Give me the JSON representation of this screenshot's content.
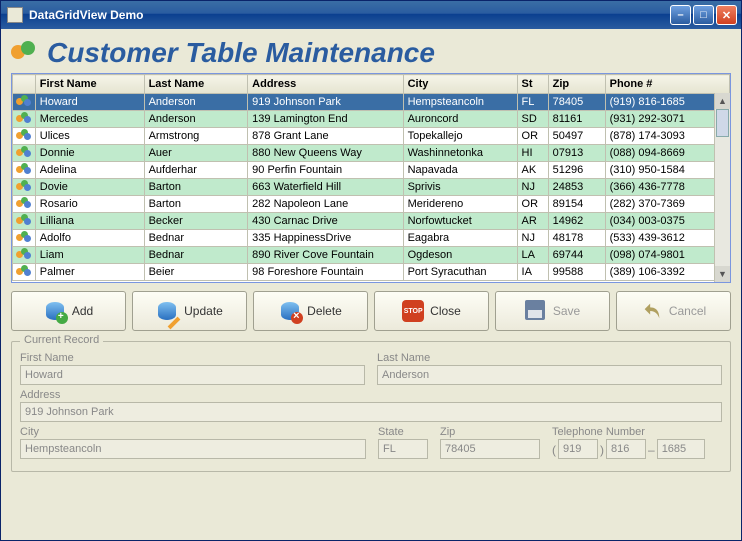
{
  "window": {
    "title": "DataGridView Demo"
  },
  "heading": "Customer Table Maintenance",
  "columns": {
    "first": "First Name",
    "last": "Last Name",
    "address": "Address",
    "city": "City",
    "st": "St",
    "zip": "Zip",
    "phone": "Phone #"
  },
  "rows": [
    {
      "first": "Howard",
      "last": "Anderson",
      "address": "919 Johnson Park",
      "city": "Hempsteancoln",
      "st": "FL",
      "zip": "78405",
      "phone": "(919) 816-1685"
    },
    {
      "first": "Mercedes",
      "last": "Anderson",
      "address": "139 Lamington End",
      "city": "Auroncord",
      "st": "SD",
      "zip": "81161",
      "phone": "(931) 292-3071"
    },
    {
      "first": "Ulices",
      "last": "Armstrong",
      "address": "878 Grant Lane",
      "city": "Topekallejo",
      "st": "OR",
      "zip": "50497",
      "phone": "(878) 174-3093"
    },
    {
      "first": "Donnie",
      "last": "Auer",
      "address": "880 New Queens Way",
      "city": "Washinnetonka",
      "st": "HI",
      "zip": "07913",
      "phone": "(088) 094-8669"
    },
    {
      "first": "Adelina",
      "last": "Aufderhar",
      "address": "90 Perfin Fountain",
      "city": "Napavada",
      "st": "AK",
      "zip": "51296",
      "phone": "(310) 950-1584"
    },
    {
      "first": "Dovie",
      "last": "Barton",
      "address": "663 Waterfield Hill",
      "city": "Sprivis",
      "st": "NJ",
      "zip": "24853",
      "phone": "(366) 436-7778"
    },
    {
      "first": "Rosario",
      "last": "Barton",
      "address": "282 Napoleon Lane",
      "city": "Meridereno",
      "st": "OR",
      "zip": "89154",
      "phone": "(282) 370-7369"
    },
    {
      "first": "Lilliana",
      "last": "Becker",
      "address": "430 Carnac Drive",
      "city": "Norfowtucket",
      "st": "AR",
      "zip": "14962",
      "phone": "(034) 003-0375"
    },
    {
      "first": "Adolfo",
      "last": "Bednar",
      "address": "335 HappinessDrive",
      "city": "Eagabra",
      "st": "NJ",
      "zip": "48178",
      "phone": "(533) 439-3612"
    },
    {
      "first": "Liam",
      "last": "Bednar",
      "address": "890 River Cove Fountain",
      "city": "Ogdeson",
      "st": "LA",
      "zip": "69744",
      "phone": "(098) 074-9801"
    },
    {
      "first": "Palmer",
      "last": "Beier",
      "address": "98 Foreshore Fountain",
      "city": "Port Syracuthan",
      "st": "IA",
      "zip": "99588",
      "phone": "(389) 106-3392"
    }
  ],
  "buttons": {
    "add": "Add",
    "update": "Update",
    "delete": "Delete",
    "close": "Close",
    "save": "Save",
    "cancel": "Cancel",
    "stop": "STOP"
  },
  "form": {
    "legend": "Current Record",
    "labels": {
      "first": "First Name",
      "last": "Last Name",
      "address": "Address",
      "city": "City",
      "state": "State",
      "zip": "Zip",
      "phone": "Telephone Number"
    },
    "values": {
      "first": "Howard",
      "last": "Anderson",
      "address": "919 Johnson Park",
      "city": "Hempsteancoln",
      "state": "FL",
      "zip": "78405",
      "phone_area": "919",
      "phone_exch": "816",
      "phone_num": "1685"
    },
    "punct": {
      "lp": "(",
      "rp": ")",
      "dash": "–"
    }
  }
}
